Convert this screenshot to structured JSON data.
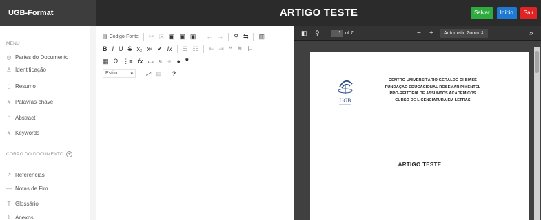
{
  "app": {
    "brand": "UGB-Format",
    "title": "ARTIGO TESTE",
    "actions": [
      {
        "label": "Salvar",
        "color": "#2eaa3f"
      },
      {
        "label": "Início",
        "color": "#1f78d1"
      },
      {
        "label": "Sair",
        "color": "#e02424"
      }
    ]
  },
  "sidebar": {
    "menu_heading": "MENU",
    "items": [
      {
        "label": "Partes do Documento",
        "icon": "layers-icon"
      },
      {
        "label": "Identificação",
        "icon": "user-icon"
      },
      {
        "label": "Resumo",
        "icon": "document-icon"
      },
      {
        "label": "Palavras-chave",
        "icon": "hash-icon"
      },
      {
        "label": "Abstract",
        "icon": "document-icon"
      },
      {
        "label": "Keywords",
        "icon": "hash-icon"
      }
    ],
    "body_heading": "CORPO DO DOCUMENTO",
    "extras": [
      {
        "label": "Referências",
        "icon": "link-icon"
      },
      {
        "label": "Notas de Fim",
        "icon": "dash-icon"
      },
      {
        "label": "Glossário",
        "icon": "text-icon"
      },
      {
        "label": "Anexos",
        "icon": "paperclip-icon"
      }
    ]
  },
  "editor": {
    "source_label": "Código-Fonte",
    "style_label": "Estilo"
  },
  "pdf": {
    "page_current": "1",
    "page_total": "of 7",
    "zoom": "Automatic Zoom",
    "institution_lines": [
      "CENTRO UNIVERSITÁRIO GERALDO DI BIASE",
      "FUNDAÇÃO EDUCACIONAL ROSEMAR PIMENTEL",
      "PRÓ-REITORIA DE ASSUNTOS ACADÊMICOS",
      "CURSO DE LICENCIATURA EM LETRAS"
    ],
    "doc_title": "ARTIGO TESTE",
    "logo_text": "UGB"
  }
}
